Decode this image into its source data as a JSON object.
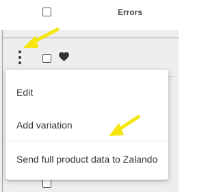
{
  "table": {
    "columns": [
      {
        "header": "Errors"
      }
    ]
  },
  "row": {
    "favorite_icon": "heart-icon",
    "actions_icon": "more-vertical-icon"
  },
  "menu": {
    "items": [
      {
        "label": "Edit"
      },
      {
        "label": "Add variation"
      },
      {
        "label": "Send full product data to Zalando"
      }
    ]
  },
  "annotations": {
    "arrow_color": "#f5e60f"
  }
}
